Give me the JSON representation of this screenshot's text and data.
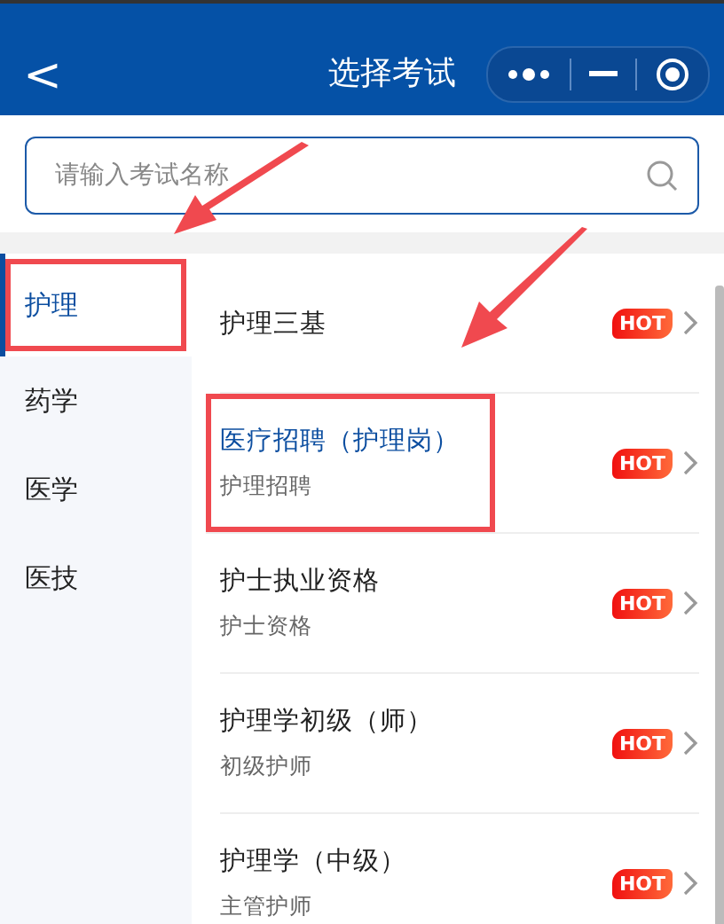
{
  "header": {
    "back": "<",
    "title": "选择考试"
  },
  "search": {
    "placeholder": "请输入考试名称"
  },
  "categories": [
    {
      "label": "护理",
      "selected": true,
      "annotated": true
    },
    {
      "label": "药学",
      "selected": false,
      "annotated": false
    },
    {
      "label": "医学",
      "selected": false,
      "annotated": false
    },
    {
      "label": "医技",
      "selected": false,
      "annotated": false
    }
  ],
  "exams": [
    {
      "title": "护理三基",
      "badge": "HOT",
      "highlighted": false,
      "annotated": false
    },
    {
      "title": "医疗招聘（护理岗）",
      "subtitle": "护理招聘",
      "badge": "HOT",
      "highlighted": true,
      "annotated": true
    },
    {
      "title": "护士执业资格",
      "subtitle": "护士资格",
      "badge": "HOT",
      "highlighted": false,
      "annotated": false
    },
    {
      "title": "护理学初级（师）",
      "subtitle": "初级护师",
      "badge": "HOT",
      "highlighted": false,
      "annotated": false
    },
    {
      "title": "护理学（中级）",
      "subtitle": "主管护师",
      "badge": "HOT",
      "highlighted": false,
      "annotated": false
    }
  ]
}
